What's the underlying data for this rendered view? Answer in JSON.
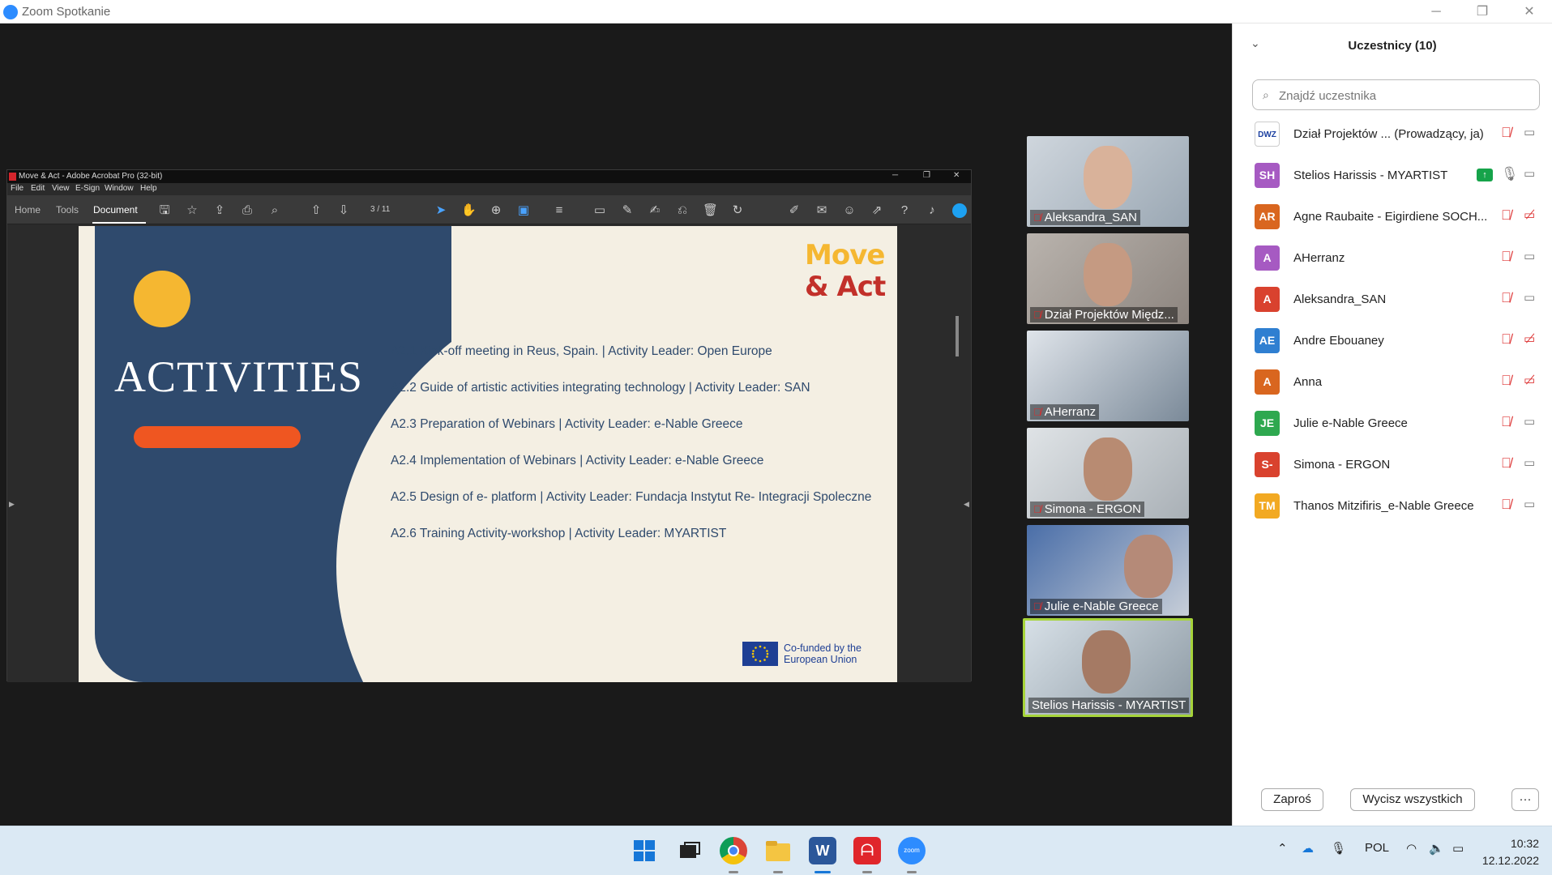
{
  "window": {
    "title": "Zoom Spotkanie",
    "controls": {
      "minimize": "─",
      "restore": "❐",
      "close": "✕"
    }
  },
  "acrobat": {
    "title": "Move & Act - Adobe Acrobat Pro (32-bit)",
    "menu": [
      "File",
      "Edit",
      "View",
      "E-Sign",
      "Window",
      "Help"
    ],
    "tabs": [
      "Home",
      "Tools",
      "Document"
    ],
    "active_tab": "Document",
    "page_indicator": "3 / 11",
    "controls": {
      "minimize": "─",
      "restore": "❐",
      "close": "✕"
    }
  },
  "slide": {
    "heading": "ACTIVITIES",
    "logo_line1": "Move",
    "logo_line2": "& Act",
    "activities": [
      "A2.1 Kick-off meeting in Reus, Spain. | Activity Leader: Open Europe",
      "A2.2 Guide of artistic activities integrating technology | Activity Leader: SAN",
      "A2.3 Preparation of Webinars | Activity Leader: e-Nable Greece",
      "A2.4 Implementation of Webinars | Activity Leader: e-Nable Greece",
      "A2.5 Design of e- platform | Activity Leader: Fundacja Instytut Re- Integracji Spoleczne",
      "A2.6 Training Activity-workshop | Activity Leader: MYARTIST"
    ],
    "eu_line1": "Co-funded by the",
    "eu_line2": "European Union",
    "colors": {
      "blue": "#2f4a6d",
      "cream": "#f4efe3",
      "yellow": "#f5b731",
      "orange": "#ef5621",
      "red": "#c2302a"
    }
  },
  "videos": [
    {
      "name": "Aleksandra_SAN",
      "muted": true
    },
    {
      "name": "Dział Projektów Międz...",
      "muted": true
    },
    {
      "name": "AHerranz",
      "muted": true
    },
    {
      "name": "Simona - ERGON",
      "muted": true
    },
    {
      "name": "Julie e-Nable Greece",
      "muted": true
    },
    {
      "name": "Stelios Harissis - MYARTIST",
      "muted": false,
      "active_speaker": true
    }
  ],
  "panel": {
    "title": "Uczestnicy (10)",
    "search_placeholder": "Znajdź uczestnika",
    "participants": [
      {
        "initials": "DWZ",
        "name": "Dział Projektów ...   (Prowadzący, ja)",
        "color": "#ffffff",
        "mic": "muted",
        "cam": "on"
      },
      {
        "initials": "SH",
        "name": "Stelios Harissis - MYARTIST",
        "color": "#a65ac2",
        "mic": "on",
        "cam": "on",
        "sharing": true
      },
      {
        "initials": "AR",
        "name": "Agne Raubaite - Eigirdiene SOCH...",
        "color": "#d9661f",
        "mic": "muted",
        "cam": "off"
      },
      {
        "initials": "A",
        "name": "AHerranz",
        "color": "#a65ac2",
        "mic": "muted",
        "cam": "on"
      },
      {
        "initials": "A",
        "name": "Aleksandra_SAN",
        "color": "#d9422e",
        "mic": "muted",
        "cam": "on"
      },
      {
        "initials": "AE",
        "name": "Andre Ebouaney",
        "color": "#2f7fd1",
        "mic": "muted",
        "cam": "off"
      },
      {
        "initials": "A",
        "name": "Anna",
        "color": "#d9661f",
        "mic": "muted",
        "cam": "off"
      },
      {
        "initials": "JE",
        "name": "Julie e-Nable Greece",
        "color": "#2ea84f",
        "mic": "muted",
        "cam": "on"
      },
      {
        "initials": "S-",
        "name": "Simona - ERGON",
        "color": "#d9422e",
        "mic": "muted",
        "cam": "on"
      },
      {
        "initials": "TM",
        "name": "Thanos Mitzifiris_e-Nable Greece",
        "color": "#f2a922",
        "mic": "muted",
        "cam": "on"
      }
    ],
    "invite_label": "Zaproś",
    "mute_all_label": "Wycisz wszystkich",
    "more_label": "···"
  },
  "taskbar": {
    "apps": [
      "windows-start",
      "task-view",
      "chrome",
      "file-explorer",
      "word",
      "acrobat",
      "zoom"
    ],
    "language": "POL",
    "time": "10:32",
    "date": "12.12.2022"
  }
}
